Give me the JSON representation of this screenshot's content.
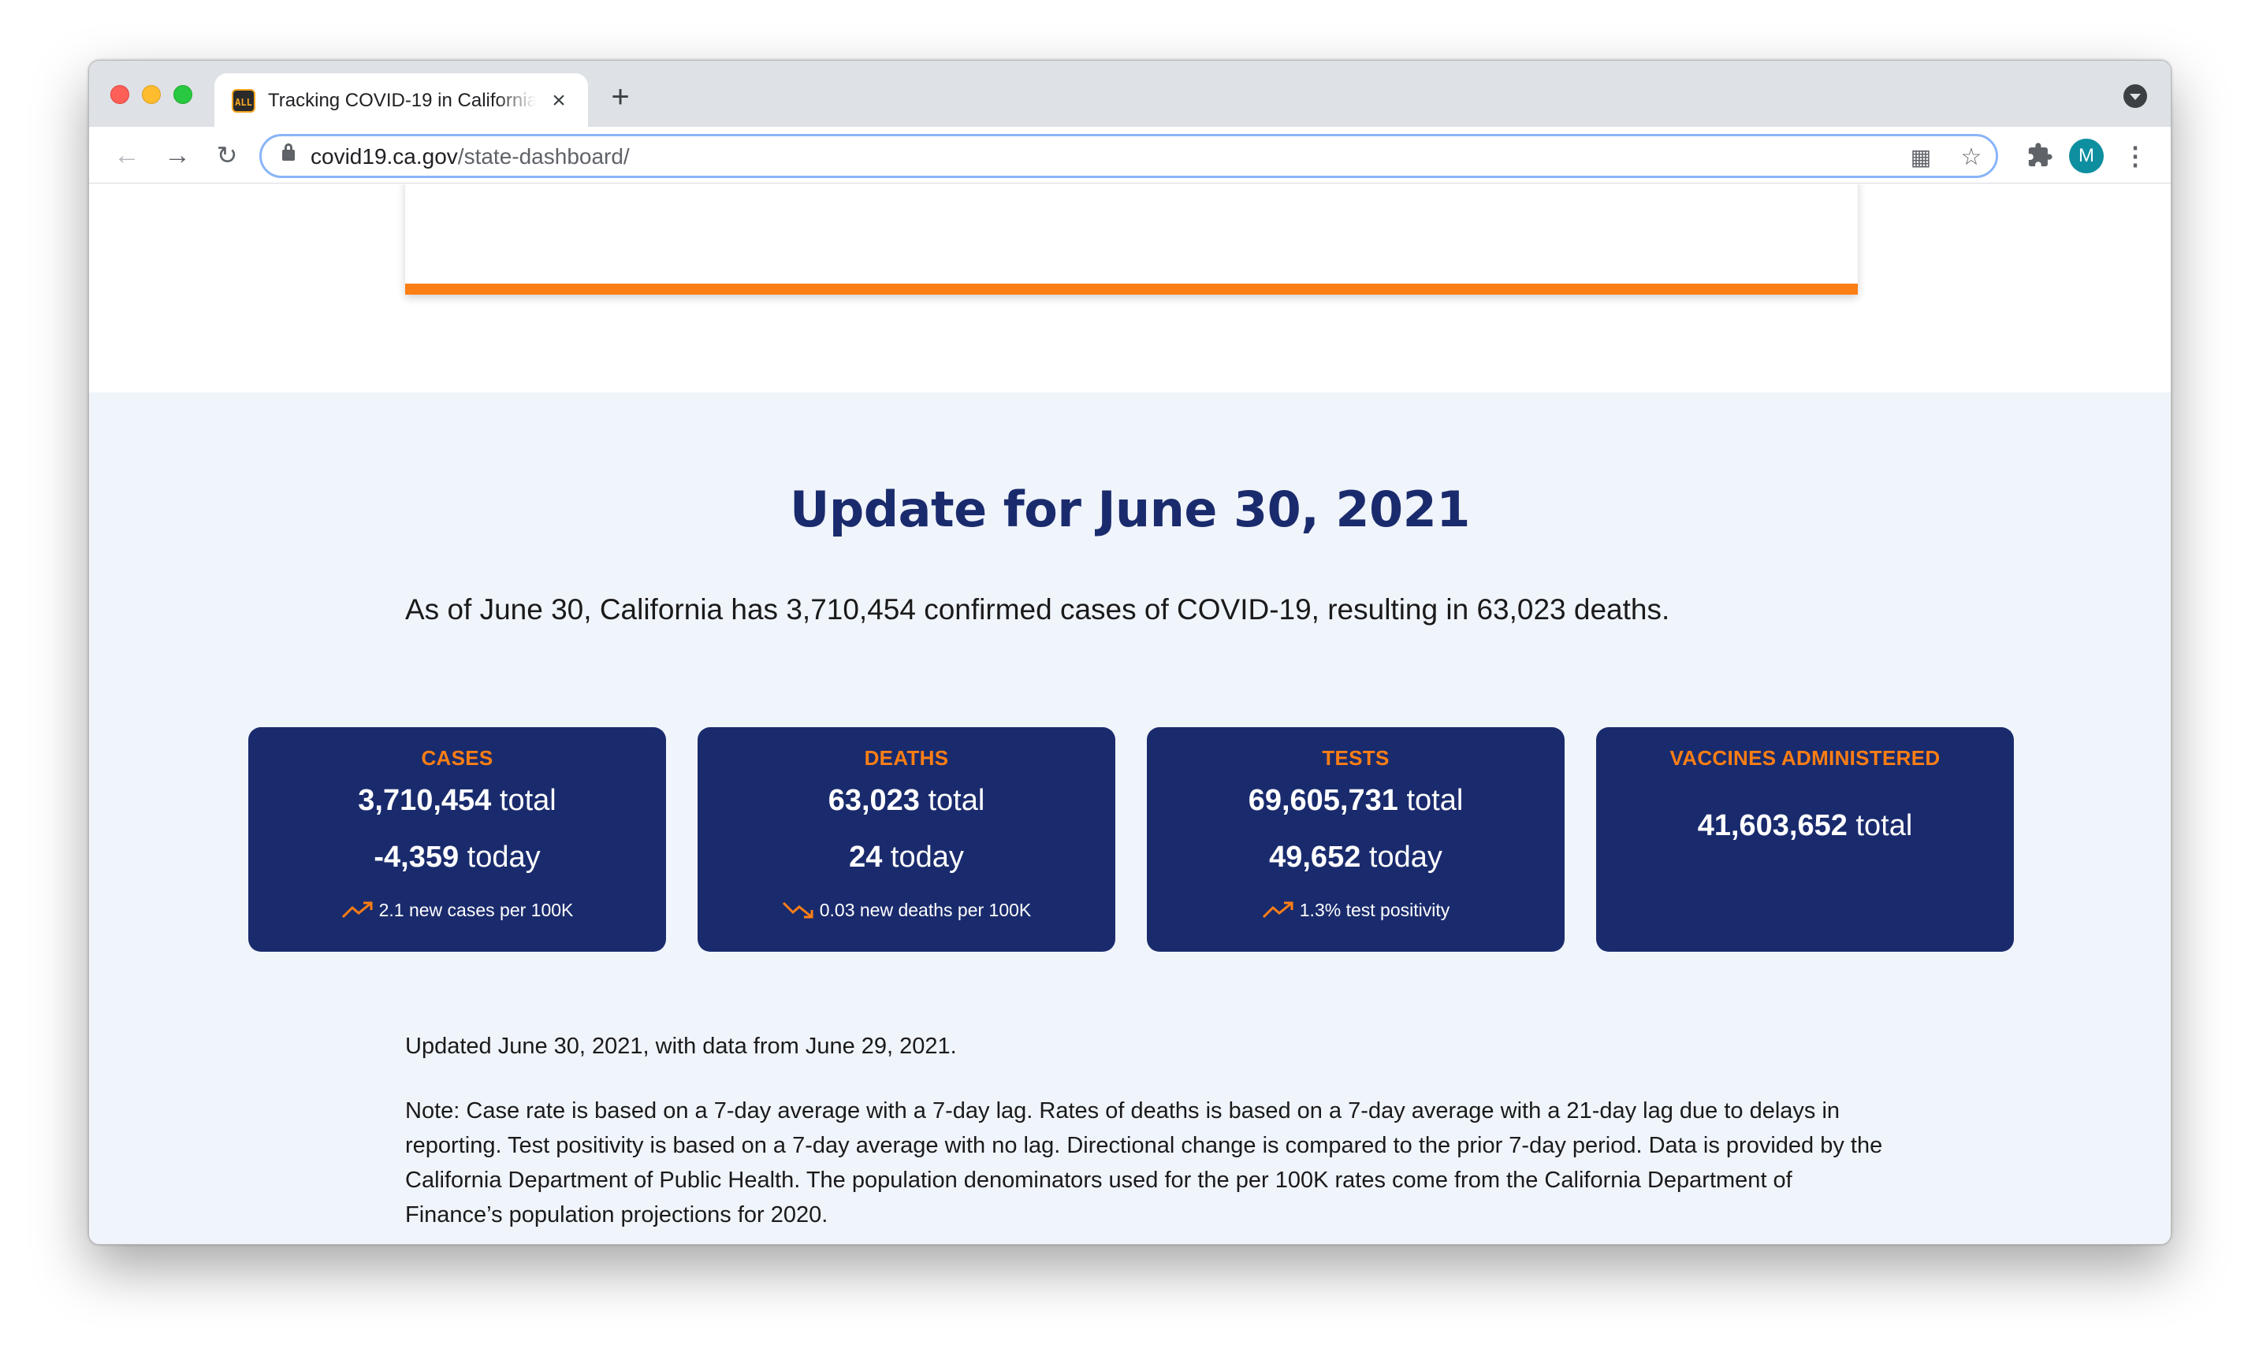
{
  "browser": {
    "tab_title": "Tracking COVID-19 in California",
    "favicon_text": "ALL",
    "close_glyph": "×",
    "new_tab_glyph": "+",
    "url_host": "covid19.ca.gov",
    "url_path": "/state-dashboard/",
    "avatar_initial": "M"
  },
  "page": {
    "title": "Update for June 30, 2021",
    "summary": "As of June 30, California has 3,710,454 confirmed cases of COVID-19, resulting in 63,023 deaths.",
    "updated": "Updated June 30, 2021, with data from June 29, 2021.",
    "note": "Note: Case rate is based on a 7-day average with a 7-day lag. Rates of deaths is based on a 7-day average with a 21-day lag due to delays in reporting. Test positivity is based on a 7-day average with no lag. Directional change is compared to the prior 7-day period. Data is provided by the California Department of Public Health. The population denominators used for the per 100K rates come from the California Department of Finance’s population projections for 2020."
  },
  "cards": {
    "cases": {
      "label": "CASES",
      "total_value": "3,710,454",
      "total_suffix": " total",
      "today_value": "-4,359",
      "today_suffix": " today",
      "trend_text": "2.1 new cases per 100K",
      "trend_direction": "up"
    },
    "deaths": {
      "label": "DEATHS",
      "total_value": "63,023",
      "total_suffix": " total",
      "today_value": "24",
      "today_suffix": " today",
      "trend_text": "0.03 new deaths per 100K",
      "trend_direction": "down"
    },
    "tests": {
      "label": "TESTS",
      "total_value": "69,605,731",
      "total_suffix": " total",
      "today_value": "49,652",
      "today_suffix": " today",
      "trend_text": "1.3% test positivity",
      "trend_direction": "up"
    },
    "vaccines": {
      "label": "VACCINES ADMINISTERED",
      "total_value": "41,603,652",
      "total_suffix": " total"
    }
  },
  "colors": {
    "card_bg": "#1a2b6d",
    "accent_orange": "#fd7e14",
    "section_bg": "#f0f4fb"
  }
}
